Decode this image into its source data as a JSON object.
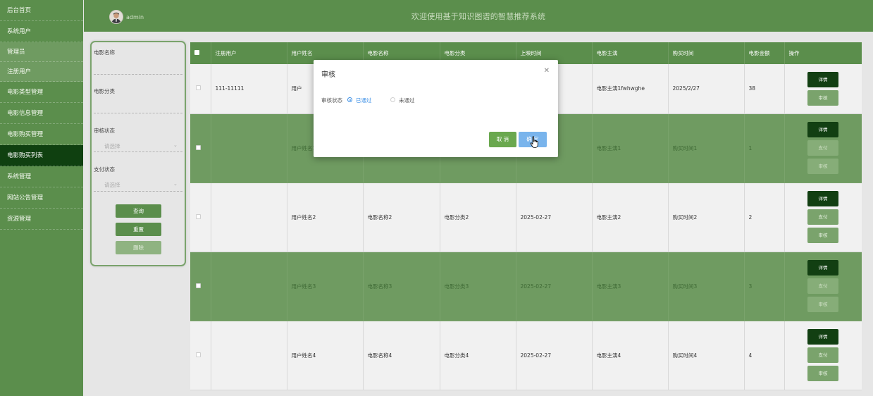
{
  "sidebar": {
    "items": [
      {
        "label": "后台首页"
      },
      {
        "label": "系统用户"
      },
      {
        "label": "管理员"
      },
      {
        "label": "注册用户"
      },
      {
        "label": "电影类型管理"
      },
      {
        "label": "电影信息管理"
      },
      {
        "label": "电影购买管理"
      },
      {
        "label": "电影购买列表"
      },
      {
        "label": "系统管理"
      },
      {
        "label": "网站公告管理"
      },
      {
        "label": "资源管理"
      }
    ]
  },
  "header": {
    "username": "admin",
    "title": "欢迎使用基于知识图谱的智慧推荐系统"
  },
  "search": {
    "movie_name_label": "电影名称",
    "movie_category_label": "电影分类",
    "review_status_label": "审核状态",
    "review_status_placeholder": "请选择",
    "pay_status_label": "支付状态",
    "pay_status_placeholder": "请选择",
    "query_button": "查询",
    "reset_button": "重置",
    "delete_button": "删除"
  },
  "table": {
    "headers": [
      "注册用户",
      "用户姓名",
      "电影名称",
      "电影分类",
      "上映时间",
      "电影主演",
      "购买时间",
      "电影金额",
      "操作"
    ],
    "rows": [
      {
        "user": "111-11111",
        "name": "用户",
        "movie": "",
        "category": "",
        "release": "",
        "actor": "电影主演1fwhwghe",
        "buy_time": "2025/2/27",
        "amount": "38",
        "ops": [
          "详情",
          "审核"
        ]
      },
      {
        "user": "",
        "name": "用户姓名1",
        "movie": "",
        "category": "",
        "release": "",
        "actor": "电影主演1",
        "buy_time": "购买时间1",
        "amount": "1",
        "ops": [
          "详情",
          "支付",
          "审核"
        ]
      },
      {
        "user": "",
        "name": "用户姓名2",
        "movie": "电影名称2",
        "category": "电影分类2",
        "release": "2025-02-27",
        "actor": "电影主演2",
        "buy_time": "购买时间2",
        "amount": "2",
        "ops": [
          "详情",
          "支付",
          "审核"
        ]
      },
      {
        "user": "",
        "name": "用户姓名3",
        "movie": "电影名称3",
        "category": "电影分类3",
        "release": "2025-02-27",
        "actor": "电影主演3",
        "buy_time": "购买时间3",
        "amount": "3",
        "ops": [
          "详情",
          "支付",
          "审核"
        ]
      },
      {
        "user": "",
        "name": "用户姓名4",
        "movie": "电影名称4",
        "category": "电影分类4",
        "release": "2025-02-27",
        "actor": "电影主演4",
        "buy_time": "购买时间4",
        "amount": "4",
        "ops": [
          "详情",
          "支付",
          "审核"
        ]
      }
    ]
  },
  "modal": {
    "title": "审核",
    "close_icon": "close-icon",
    "status_label": "审核状态",
    "option_pass": "已通过",
    "option_fail": "未通过",
    "selected": "已通过",
    "cancel_button": "取 消",
    "confirm_button": "确 定"
  },
  "colors": {
    "primary_green": "#5b8e4c",
    "dark_green": "#123f12",
    "radio_blue": "#3a8ee6",
    "confirm_blue": "#79b4ec"
  }
}
